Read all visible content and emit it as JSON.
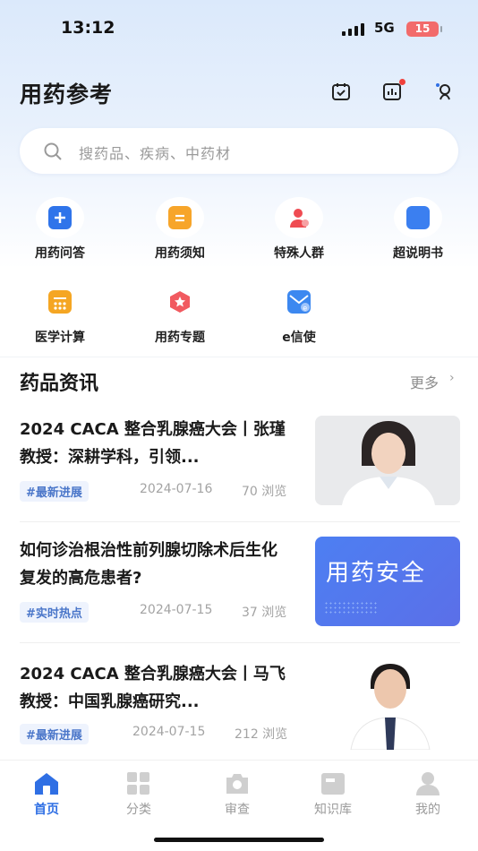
{
  "status_bar": {
    "time": "13:12",
    "network": "5G",
    "battery": "15"
  },
  "header": {
    "title": "用药参考",
    "icons": [
      "calendar-check-icon",
      "chart-icon",
      "user-settings-icon"
    ]
  },
  "search": {
    "placeholder": "搜药品、疾病、中药材"
  },
  "quick_grid": [
    {
      "label": "用药问答",
      "icon": "medication-qa-icon",
      "color": "#2f74ea"
    },
    {
      "label": "用药须知",
      "icon": "medication-notice-icon",
      "color": "#f7a52a"
    },
    {
      "label": "特殊人群",
      "icon": "special-group-icon",
      "color": "#ef4b52"
    },
    {
      "label": "超说明书",
      "icon": "off-label-icon",
      "color": "#3b7ff0"
    },
    {
      "label": "医学计算",
      "icon": "calculator-icon",
      "color": "#f5a623"
    },
    {
      "label": "用药专题",
      "icon": "topic-icon",
      "color": "#f15a60"
    },
    {
      "label": "e信使",
      "icon": "e-messenger-icon",
      "color": "#3c88f0"
    }
  ],
  "news_section": {
    "title": "药品资讯",
    "more": "更多"
  },
  "news": [
    {
      "title": "2024 CACA 整合乳腺癌大会丨张瑾教授：深耕学科，引领...",
      "tag": "#最新进展",
      "date": "2024-07-16",
      "views": "70 浏览",
      "thumb": "doctor-photo-female"
    },
    {
      "title": "如何诊治根治性前列腺切除术后生化复发的高危患者?",
      "tag": "#实时热点",
      "date": "2024-07-15",
      "views": "37 浏览",
      "thumb_text": "用药安全"
    },
    {
      "title": "2024 CACA 整合乳腺癌大会丨马飞教授：中国乳腺癌研究...",
      "tag": "#最新进展",
      "date": "2024-07-15",
      "views": "212 浏览",
      "thumb": "doctor-photo-male"
    }
  ],
  "tabbar": [
    {
      "label": "首页",
      "icon": "home-icon",
      "active": true
    },
    {
      "label": "分类",
      "icon": "category-icon",
      "active": false
    },
    {
      "label": "审查",
      "icon": "camera-icon",
      "active": false
    },
    {
      "label": "知识库",
      "icon": "knowledge-icon",
      "active": false
    },
    {
      "label": "我的",
      "icon": "profile-icon",
      "active": false
    }
  ],
  "colors": {
    "accent": "#2f6fe4",
    "tag_text": "#4a76c9",
    "tag_bg": "#eef3fd"
  }
}
